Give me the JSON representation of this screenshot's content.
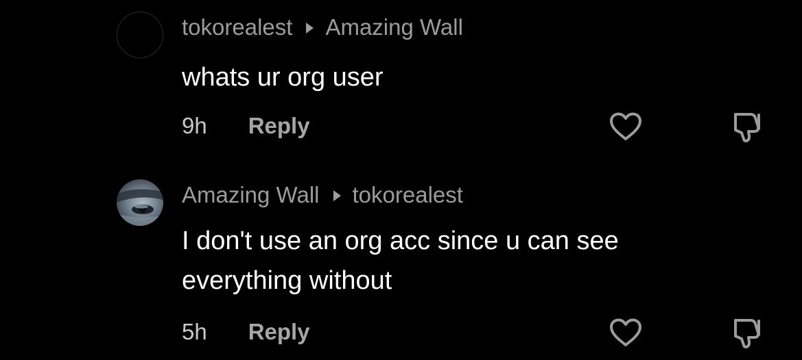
{
  "comments": [
    {
      "author": "tokorealest",
      "reply_to": "Amazing Wall",
      "text": "whats ur org user",
      "time": "9h",
      "reply_label": "Reply",
      "avatar_icon": "empty-avatar"
    },
    {
      "author": "Amazing Wall",
      "reply_to": "tokorealest",
      "text": "I don't use an org acc since u can see everything without",
      "time": "5h",
      "reply_label": "Reply",
      "avatar_icon": "eye-photo-avatar"
    }
  ],
  "icons": {
    "reply_arrow": "caret-right-icon",
    "like": "heart-outline-icon",
    "dislike": "thumbs-down-outline-icon"
  },
  "colors": {
    "background": "#000000",
    "primary_text": "#ffffff",
    "secondary_text": "#9c9c9c"
  }
}
